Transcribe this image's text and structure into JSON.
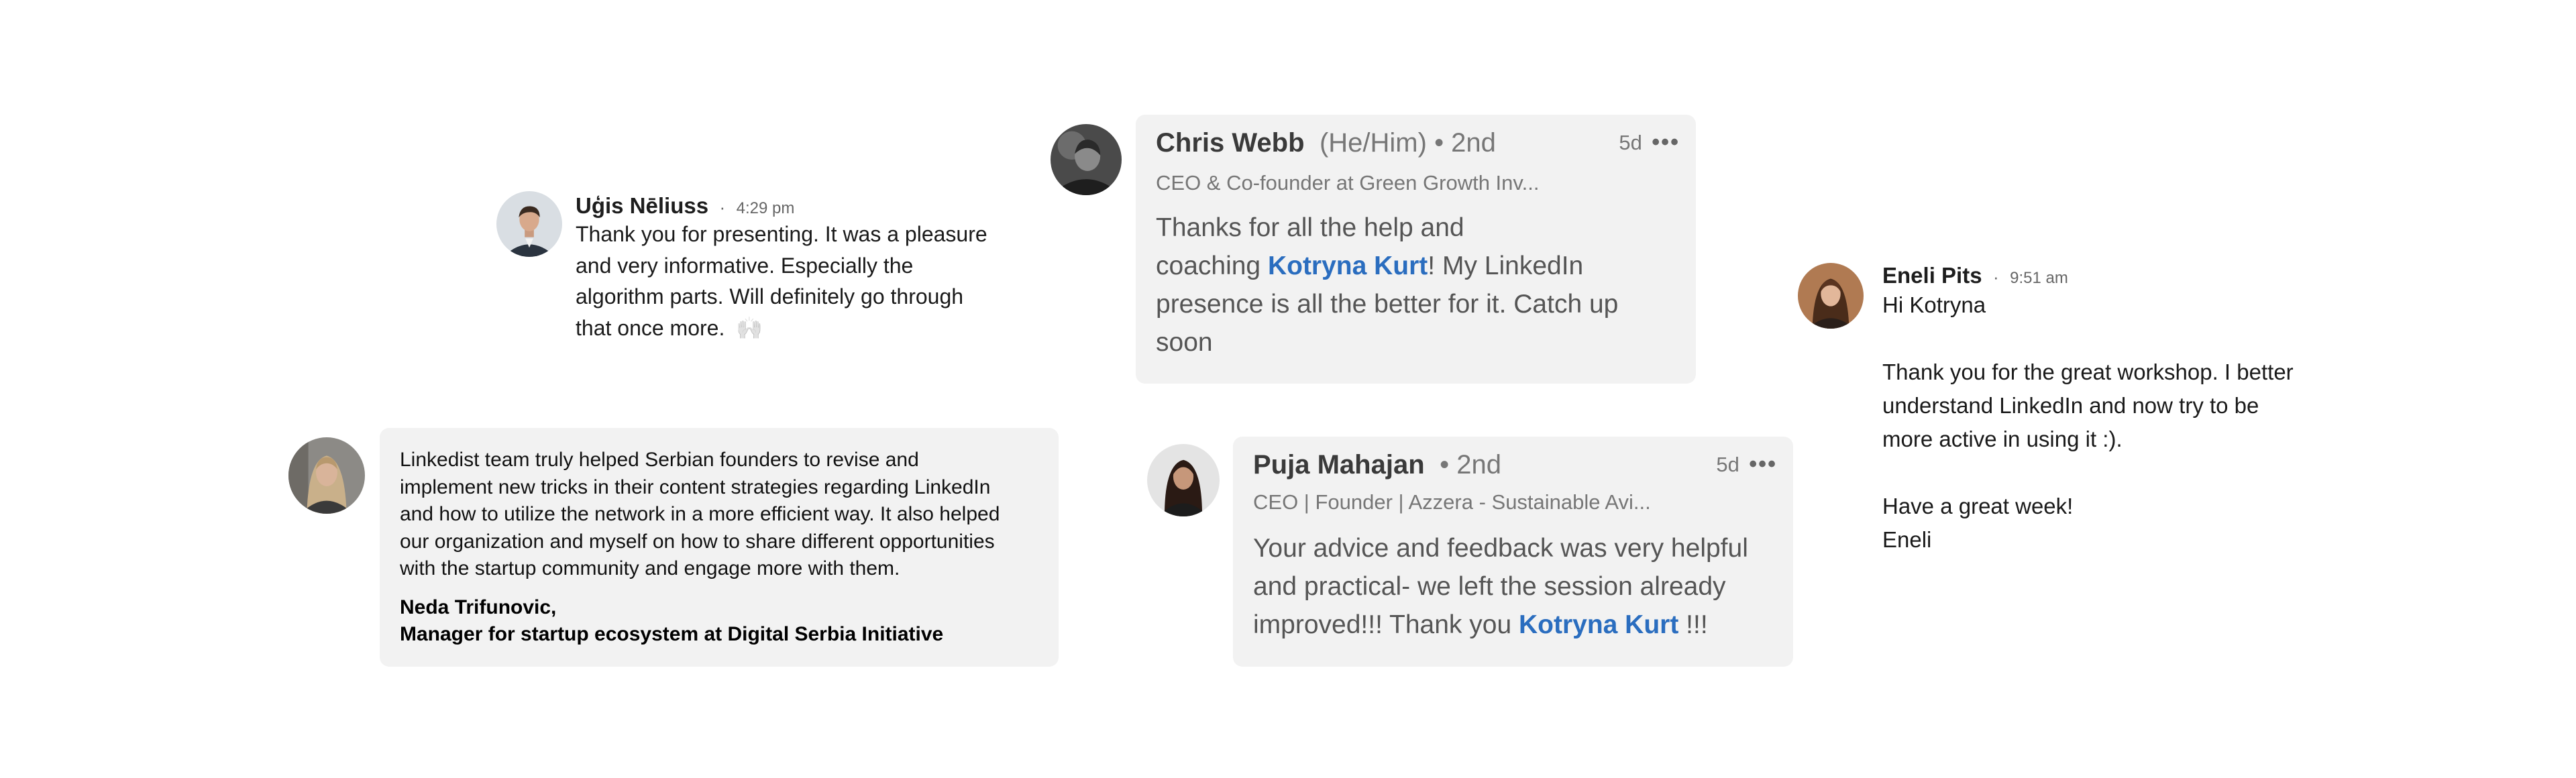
{
  "ugis": {
    "name": "Uģis Nēliuss",
    "separator": "·",
    "time": "4:29 pm",
    "lines": [
      "Thank you for presenting. It was a pleasure",
      "and very informative. Especially the",
      "algorithm parts. Will definitely go through",
      "that once more."
    ],
    "emoji": "🙌"
  },
  "chris": {
    "name": "Chris Webb",
    "meta": "(He/Him) • 2nd",
    "headline": "CEO & Co-founder at Green Growth Inv...",
    "age": "5d",
    "more": "•••",
    "text_1": "Thanks for all the help and",
    "text_2_pre": "coaching ",
    "mention": "Kotryna Kurt",
    "text_2_post": "! My LinkedIn",
    "text_3": "presence is all the better for it. Catch up",
    "text_4": "soon"
  },
  "eneli": {
    "name": "Eneli Pits",
    "separator": "·",
    "time": "9:51 am",
    "greeting": "Hi Kotryna",
    "para1": [
      "Thank you for the great workshop. I better",
      "understand LinkedIn and now try to be",
      "more active in using it :)."
    ],
    "closing": "Have a great week!",
    "signoff": "Eneli"
  },
  "neda": {
    "lines": [
      "Linkedist team truly helped Serbian founders to revise and",
      "implement new tricks in their content strategies regarding LinkedIn",
      "and how to utilize the network in a more efficient way. It also helped",
      "our organization and myself on how to share different opportunities",
      "with the startup community and engage more with them."
    ],
    "author_name": "Neda Trifunovic,",
    "author_title": "Manager for startup ecosystem at Digital Serbia Initiative"
  },
  "puja": {
    "name": "Puja Mahajan",
    "meta": "• 2nd",
    "headline": "CEO | Founder | Azzera - Sustainable Avi...",
    "age": "5d",
    "more": "•••",
    "text_1": "Your advice and feedback was very helpful",
    "text_2": "and practical- we left the session already",
    "text_3_pre": "improved!!! Thank you ",
    "mention": "Kotryna Kurt",
    "text_3_post": " !!!"
  },
  "colors": {
    "card_bg": "#f2f2f2",
    "mention": "#2a6dbf",
    "page_bg": "#ffffff"
  }
}
